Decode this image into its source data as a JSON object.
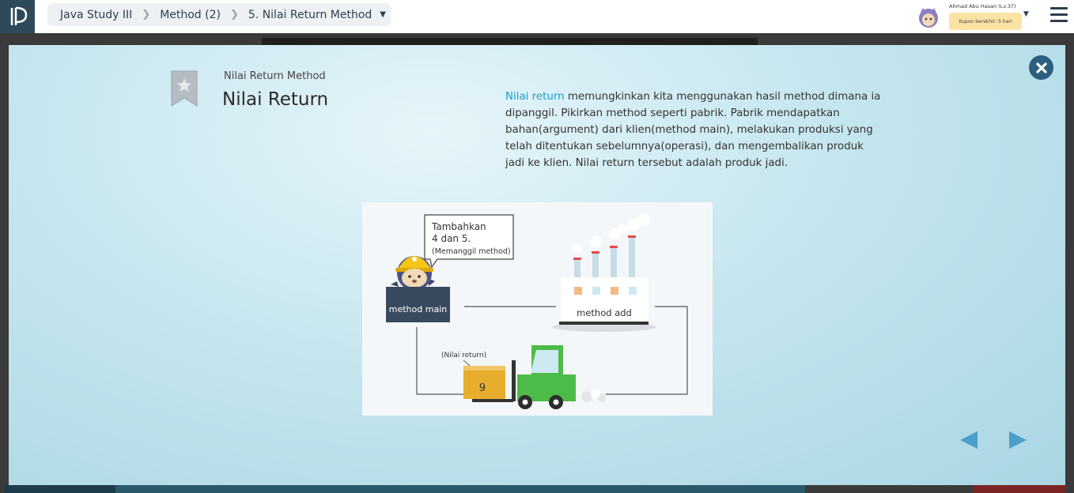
{
  "breadcrumb": {
    "items": [
      "Java Study III",
      "Method (2)",
      "5. Nilai Return Method"
    ]
  },
  "user": {
    "name": "Ahmad Abu Hasan (Lv.37)",
    "coupon": "Kupon berakhir: 5 hari"
  },
  "slide": {
    "subtitle": "Nilai Return Method",
    "title": "Nilai Return",
    "highlight": "Nilai return",
    "description": " memungkinkan kita menggunakan hasil method dimana ia dipanggil. Pikirkan method seperti pabrik. Pabrik mendapatkan bahan(argument) dari klien(method main), melakukan produksi yang telah ditentukan sebelumnya(operasi), dan mengembalikan produk jadi ke klien. Nilai return tersebut adalah produk jadi."
  },
  "illustration": {
    "bubble_line1": "Tambahkan",
    "bubble_line2": "4 dan 5.",
    "bubble_line3": "(Memanggil method)",
    "main_box": "method main",
    "factory_label": "method add",
    "return_label": "(Nilai return)",
    "box_value": "9"
  },
  "icons": {
    "logo": "logo-icon",
    "bookmark": "bookmark-star-icon",
    "close": "close-icon",
    "prev": "prev-arrow-icon",
    "next": "next-arrow-icon",
    "menu": "hamburger-menu-icon"
  },
  "colors": {
    "accent": "#1a9fd0",
    "dark": "#2c5f7e",
    "nav_arrow": "#4a9fc7"
  }
}
